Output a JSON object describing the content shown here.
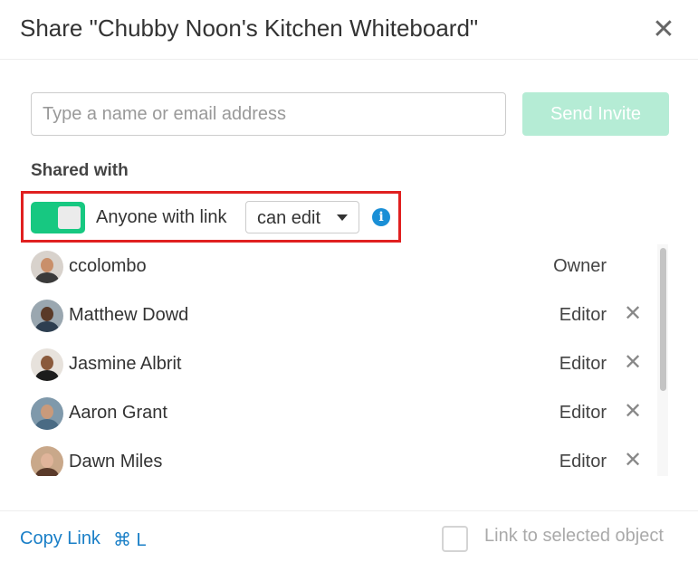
{
  "dialog": {
    "title": "Share \"Chubby Noon's Kitchen Whiteboard\"",
    "close_icon": "close-icon",
    "close_symbol": "✕"
  },
  "invite": {
    "placeholder": "Type a name or email address",
    "value": "",
    "send_label": "Send Invite",
    "send_color": "#b5ecd5"
  },
  "shared_with": {
    "label": "Shared with",
    "link_sharing": {
      "enabled": true,
      "toggle_color": "#17c881",
      "label": "Anyone with link",
      "permission": "can edit",
      "info_icon": "info-icon",
      "info_symbol": "i"
    },
    "users": [
      {
        "name": "ccolombo",
        "role": "Owner",
        "removable": false,
        "avatar": {
          "bg": "#d8d2cc",
          "face": "#c98f6a",
          "body": "#3a3a3a"
        }
      },
      {
        "name": "Matthew Dowd",
        "role": "Editor",
        "removable": true,
        "avatar": {
          "bg": "#9aa7b0",
          "face": "#5a3a28",
          "body": "#2d3e50"
        }
      },
      {
        "name": "Jasmine Albrit",
        "role": "Editor",
        "removable": true,
        "avatar": {
          "bg": "#e7e2dc",
          "face": "#8a5a3c",
          "body": "#1c1c1c"
        }
      },
      {
        "name": "Aaron Grant",
        "role": "Editor",
        "removable": true,
        "avatar": {
          "bg": "#7f99ab",
          "face": "#c99a7b",
          "body": "#4a6b84"
        }
      },
      {
        "name": "Dawn Miles",
        "role": "Editor",
        "removable": true,
        "avatar": {
          "bg": "#c9a88a",
          "face": "#e0b49a",
          "body": "#5a3a2a"
        }
      }
    ],
    "remove_icon": "remove-icon",
    "remove_symbol": "✕"
  },
  "footer": {
    "copy_link_label": "Copy Link",
    "copy_link_shortcut": "⌘ L",
    "link_to_selected_label": "Link to selected object",
    "link_to_selected_checked": false
  }
}
